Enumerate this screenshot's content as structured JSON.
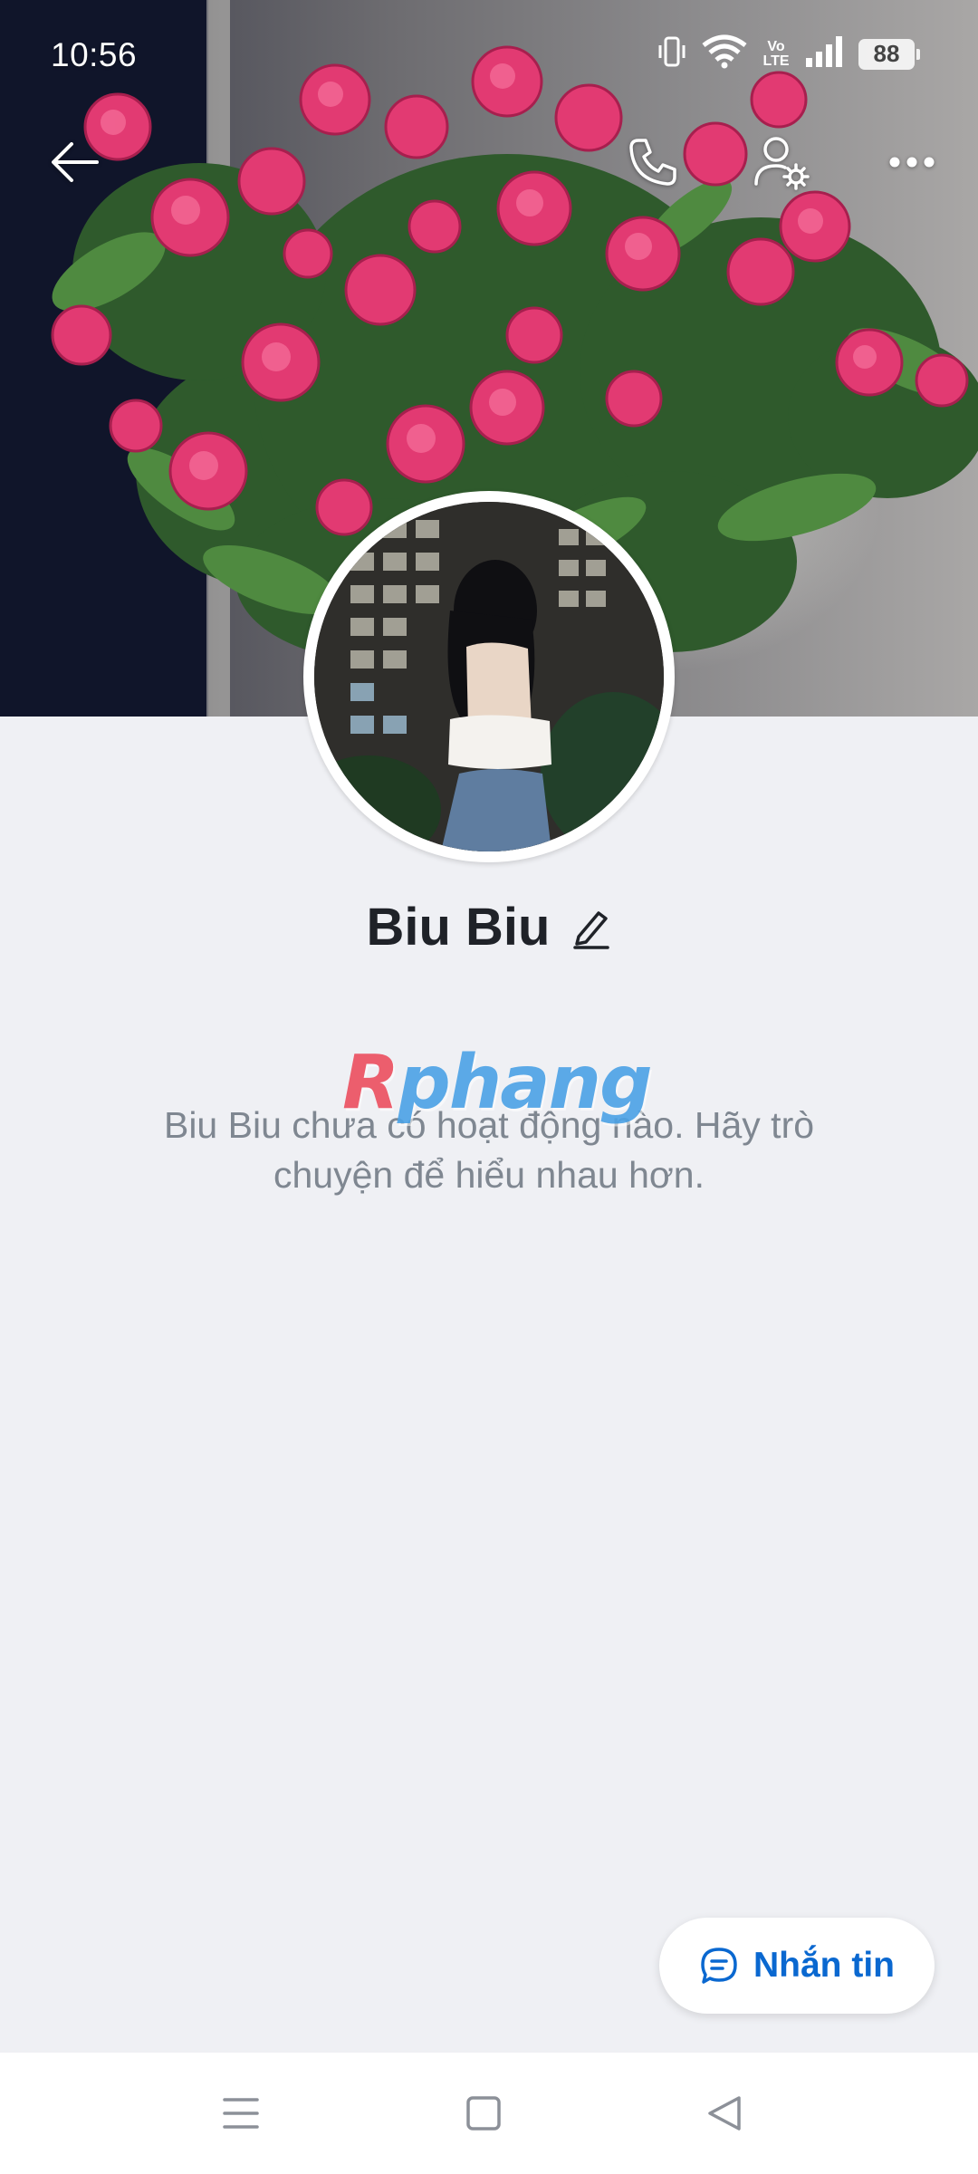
{
  "status_bar": {
    "time": "10:56",
    "battery_level": "88",
    "network_label": "Vo LTE",
    "icons": [
      "vibrate-icon",
      "wifi-icon",
      "volte-icon",
      "signal-icon",
      "battery-icon"
    ]
  },
  "header": {
    "buttons": [
      "back-arrow-icon",
      "phone-call-icon",
      "user-settings-icon",
      "more-options-icon"
    ]
  },
  "profile": {
    "name": "Biu Biu",
    "edit_icon": "pencil-icon",
    "empty_message": "Biu Biu chưa có hoạt động nào. Hãy trò chuyện để hiểu nhau hơn."
  },
  "watermark": {
    "text": "Rphang"
  },
  "message_button": {
    "label": "Nhắn tin",
    "icon": "chat-bubble-icon"
  },
  "nav_bar": {
    "buttons": [
      "recents-menu-icon",
      "home-square-icon",
      "back-triangle-icon"
    ]
  },
  "colors": {
    "accent": "#0a68d0",
    "background": "#eff0f4",
    "name_text": "#1f2228",
    "muted_text": "#7f8791"
  }
}
